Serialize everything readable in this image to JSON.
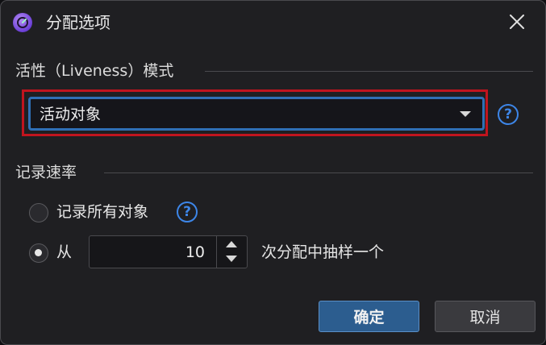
{
  "dialog": {
    "title": "分配选项",
    "app_icon": "app-logo-icon",
    "close_icon": "close-icon"
  },
  "liveness": {
    "section_title": "活性（Liveness）模式",
    "selected_value": "活动对象",
    "help_label": "?"
  },
  "record_rate": {
    "section_title": "记录速率",
    "option_all_label": "记录所有对象",
    "option_all_checked": false,
    "option_sample_prefix": "从",
    "option_sample_checked": true,
    "sample_value": "10",
    "option_sample_suffix": "次分配中抽样一个",
    "help_label": "?"
  },
  "buttons": {
    "ok_label": "确定",
    "cancel_label": "取消"
  },
  "colors": {
    "accent": "#2f6fb5",
    "help": "#3d86e8",
    "highlight": "#c0141e",
    "dialog_bg": "#1f1f22"
  }
}
